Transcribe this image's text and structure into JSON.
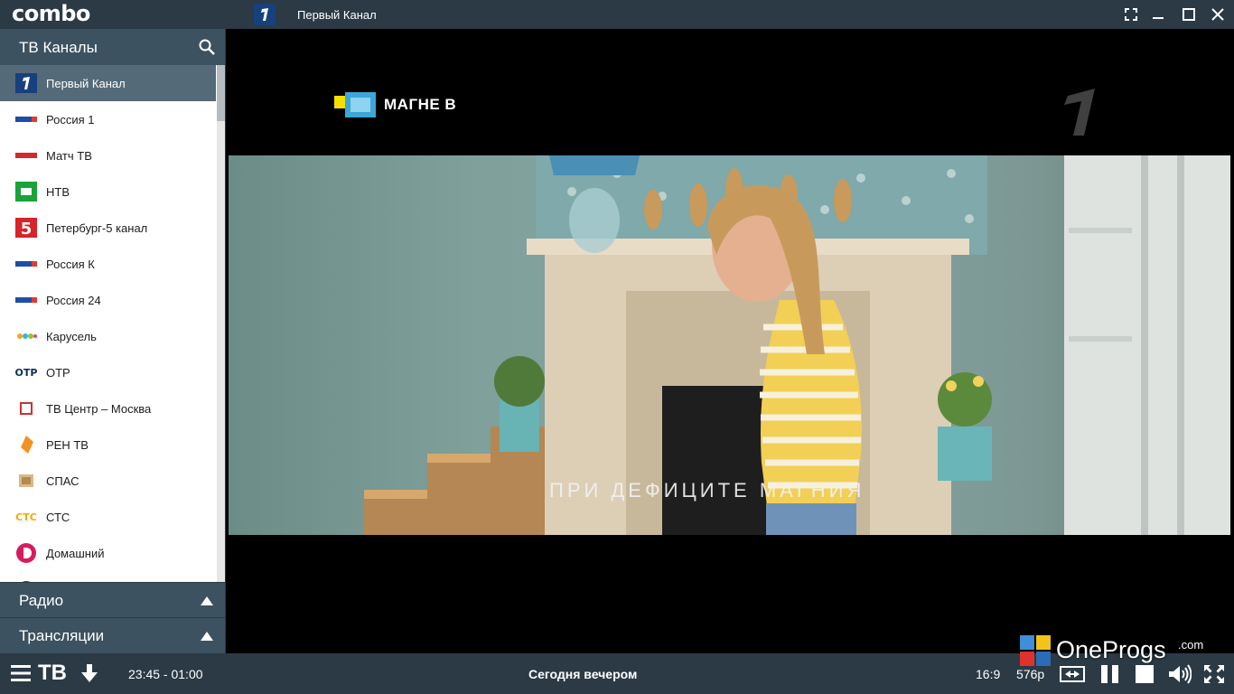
{
  "app": {
    "logo": "combo"
  },
  "titlebar": {
    "channel_name": "Первый Канал"
  },
  "sidebar": {
    "title": "ТВ Каналы",
    "channels": [
      {
        "name": "Первый Канал",
        "logo": "channel-one-logo",
        "active": true
      },
      {
        "name": "Россия 1",
        "logo": "russia1-logo"
      },
      {
        "name": "Матч ТВ",
        "logo": "match-tv-logo"
      },
      {
        "name": "НТВ",
        "logo": "ntv-logo"
      },
      {
        "name": "Петербург-5 канал",
        "logo": "channel5-logo"
      },
      {
        "name": "Россия К",
        "logo": "russia-k-logo"
      },
      {
        "name": "Россия 24",
        "logo": "russia24-logo"
      },
      {
        "name": "Карусель",
        "logo": "karusel-logo"
      },
      {
        "name": "ОТР",
        "logo": "otr-logo"
      },
      {
        "name": "ТВ Центр – Москва",
        "logo": "tvc-logo"
      },
      {
        "name": "РЕН ТВ",
        "logo": "ren-tv-logo"
      },
      {
        "name": "СПАС",
        "logo": "spas-logo"
      },
      {
        "name": "СТС",
        "logo": "sts-logo"
      },
      {
        "name": "Домашний",
        "logo": "domashniy-logo"
      }
    ],
    "sections": [
      {
        "label": "Радио"
      },
      {
        "label": "Трансляции"
      }
    ]
  },
  "video": {
    "promo_brand": "МАГНЕ В",
    "subtitle": "ПРИ ДЕФИЦИТЕ МАГНИЯ"
  },
  "bottombar": {
    "mode": "ТВ",
    "time_range": "23:45 - 01:00",
    "program": "Сегодня вечером",
    "aspect": "16:9",
    "quality": "576p"
  },
  "watermark": {
    "brand": "OneProgs",
    "suffix": ".com"
  },
  "colors": {
    "bar": "#2b3a45",
    "header": "#3d5260",
    "active_item": "#546a78",
    "channel_one_blue": "#17407d"
  }
}
